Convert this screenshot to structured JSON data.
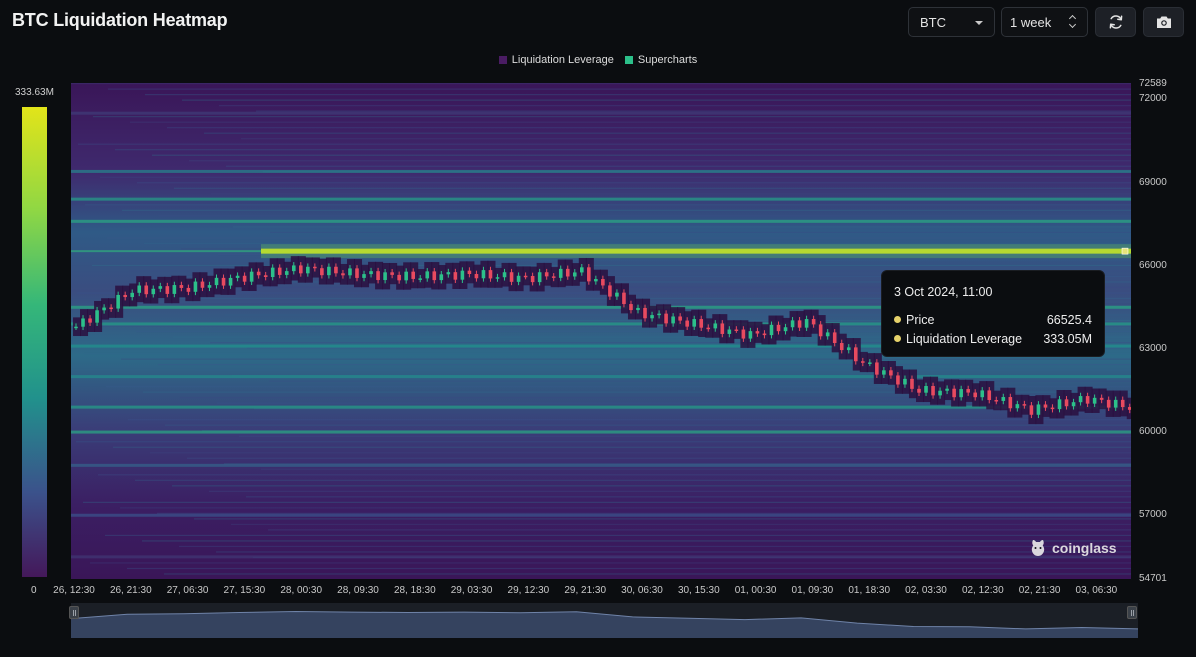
{
  "header": {
    "title": "BTC Liquidation Heatmap",
    "coin_select": "BTC",
    "range_select": "1 week"
  },
  "icons": {
    "refresh": "refresh-icon",
    "camera": "camera-icon",
    "logo": "coinglass-logo"
  },
  "legend": [
    {
      "label": "Liquidation Leverage",
      "color": "#4a1c63"
    },
    {
      "label": "Supercharts",
      "color": "#2cc08a"
    }
  ],
  "colorbar": {
    "max_label": "333.63M",
    "min_label": "0"
  },
  "watermark": "coinglass",
  "tooltip": {
    "title": "3 Oct 2024, 11:00",
    "rows": [
      {
        "label": "Price",
        "value": "66525.4",
        "color": "#e6d26a"
      },
      {
        "label": "Liquidation Leverage",
        "value": "333.05M",
        "color": "#e6d26a"
      }
    ]
  },
  "colors": {
    "heat_low": "#3d1a5c",
    "heat_mid": "#2a8d8d",
    "heat_high": "#d8e219",
    "candle_up": "#2cc08a",
    "candle_down": "#e84a5f"
  },
  "chart_data": {
    "type": "heatmap",
    "title": "BTC Liquidation Heatmap",
    "ylim": [
      54701,
      72589
    ],
    "y_ticks": [
      "72589",
      "72000",
      "69000",
      "66000",
      "63000",
      "60000",
      "57000",
      "54701"
    ],
    "x_ticks": [
      "26, 12:30",
      "26, 21:30",
      "27, 06:30",
      "27, 15:30",
      "28, 00:30",
      "28, 09:30",
      "28, 18:30",
      "29, 03:30",
      "29, 12:30",
      "29, 21:30",
      "30, 06:30",
      "30, 15:30",
      "01, 00:30",
      "01, 09:30",
      "01, 18:30",
      "02, 03:30",
      "02, 12:30",
      "02, 21:30",
      "03, 06:30"
    ],
    "colorbar_range": [
      0,
      333.63
    ],
    "price_series": {
      "name": "Price",
      "x": [
        "26, 12:30",
        "26, 21:30",
        "27, 06:30",
        "27, 15:30",
        "28, 00:30",
        "28, 09:30",
        "28, 18:30",
        "29, 03:30",
        "29, 12:30",
        "29, 21:30",
        "30, 06:30",
        "30, 15:30",
        "01, 00:30",
        "01, 09:30",
        "01, 18:30",
        "02, 03:30",
        "02, 12:30",
        "02, 21:30",
        "03, 06:30",
        "03, 11:00"
      ],
      "values": [
        63800,
        65100,
        65200,
        65600,
        65900,
        65700,
        65600,
        65700,
        65550,
        65800,
        64300,
        63900,
        63500,
        64000,
        62500,
        61500,
        61400,
        60800,
        61200,
        60800
      ]
    },
    "liquidation_bands": [
      {
        "price": 66525,
        "intensity": 1.0
      },
      {
        "price": 67600,
        "intensity": 0.5
      },
      {
        "price": 68400,
        "intensity": 0.45
      },
      {
        "price": 69400,
        "intensity": 0.35
      },
      {
        "price": 64500,
        "intensity": 0.5
      },
      {
        "price": 63900,
        "intensity": 0.45
      },
      {
        "price": 63100,
        "intensity": 0.4
      },
      {
        "price": 62000,
        "intensity": 0.38
      },
      {
        "price": 60900,
        "intensity": 0.45
      },
      {
        "price": 60000,
        "intensity": 0.5
      },
      {
        "price": 58800,
        "intensity": 0.25
      },
      {
        "price": 57000,
        "intensity": 0.2
      },
      {
        "price": 71500,
        "intensity": 0.12
      },
      {
        "price": 55500,
        "intensity": 0.1
      }
    ]
  }
}
